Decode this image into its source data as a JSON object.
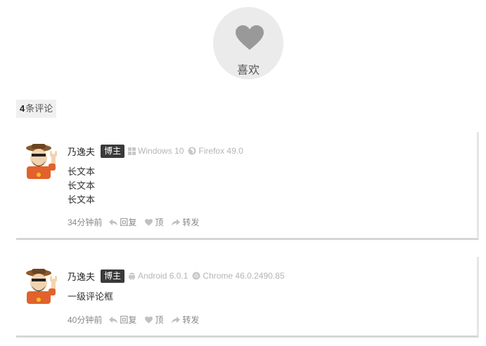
{
  "like": {
    "label": "喜欢",
    "icon": "heart-icon",
    "color": "#999999"
  },
  "comments_header": {
    "count": "4",
    "label": "条评论"
  },
  "comments": [
    {
      "author": "乃逸夫",
      "badge": "博主",
      "os": "Windows 10",
      "os_icon": "windows-icon",
      "browser": "Firefox 49.0",
      "browser_icon": "firefox-icon",
      "lines": [
        "长文本",
        "长文本",
        "长文本"
      ],
      "time": "34分钟前",
      "reply_label": "回复",
      "upvote_label": "顶",
      "forward_label": "转发"
    },
    {
      "author": "乃逸夫",
      "badge": "博主",
      "os": "Android 6.0.1",
      "os_icon": "android-icon",
      "browser": "Chrome 46.0.2490.85",
      "browser_icon": "chrome-icon",
      "lines": [
        "一级评论框"
      ],
      "time": "40分钟前",
      "reply_label": "回复",
      "upvote_label": "顶",
      "forward_label": "转发"
    }
  ],
  "colors": {
    "badge_bg": "#3a3a3a",
    "meta_gray": "#b5b5b5",
    "like_bg": "#ebebeb"
  }
}
